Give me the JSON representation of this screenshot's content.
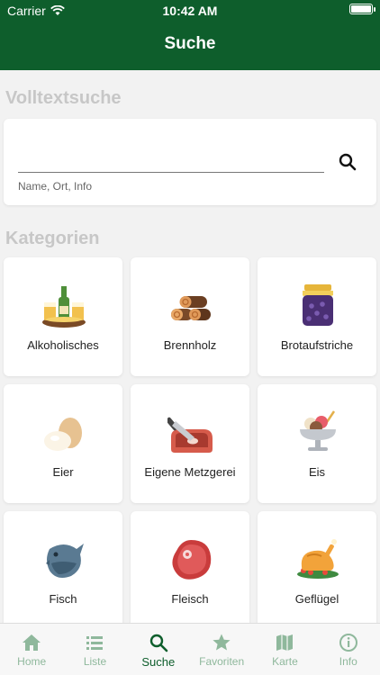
{
  "status": {
    "carrier": "Carrier",
    "time": "10:42 AM"
  },
  "nav": {
    "title": "Suche"
  },
  "fulltext": {
    "heading": "Volltextsuche",
    "input_value": "",
    "placeholder": "",
    "hint": "Name, Ort, Info"
  },
  "categories": {
    "heading": "Kategorien",
    "items": [
      {
        "label": "Alkoholisches",
        "icon": "drinks-icon"
      },
      {
        "label": "Brennholz",
        "icon": "firewood-icon"
      },
      {
        "label": "Brotaufstriche",
        "icon": "jam-jar-icon"
      },
      {
        "label": "Eier",
        "icon": "eggs-icon"
      },
      {
        "label": "Eigene Metzgerei",
        "icon": "butcher-knife-icon"
      },
      {
        "label": "Eis",
        "icon": "ice-cream-icon"
      },
      {
        "label": "Fisch",
        "icon": "fish-icon"
      },
      {
        "label": "Fleisch",
        "icon": "steak-icon"
      },
      {
        "label": "Geflügel",
        "icon": "roast-chicken-icon"
      }
    ]
  },
  "tabs": [
    {
      "label": "Home",
      "icon": "home-icon",
      "active": false
    },
    {
      "label": "Liste",
      "icon": "list-icon",
      "active": false
    },
    {
      "label": "Suche",
      "icon": "search-icon",
      "active": true
    },
    {
      "label": "Favoriten",
      "icon": "star-icon",
      "active": false
    },
    {
      "label": "Karte",
      "icon": "map-icon",
      "active": false
    },
    {
      "label": "Info",
      "icon": "info-icon",
      "active": false
    }
  ],
  "colors": {
    "brand": "#0e5e2c",
    "tab_inactive": "#8fb89c",
    "heading_muted": "#c7c7c7"
  }
}
